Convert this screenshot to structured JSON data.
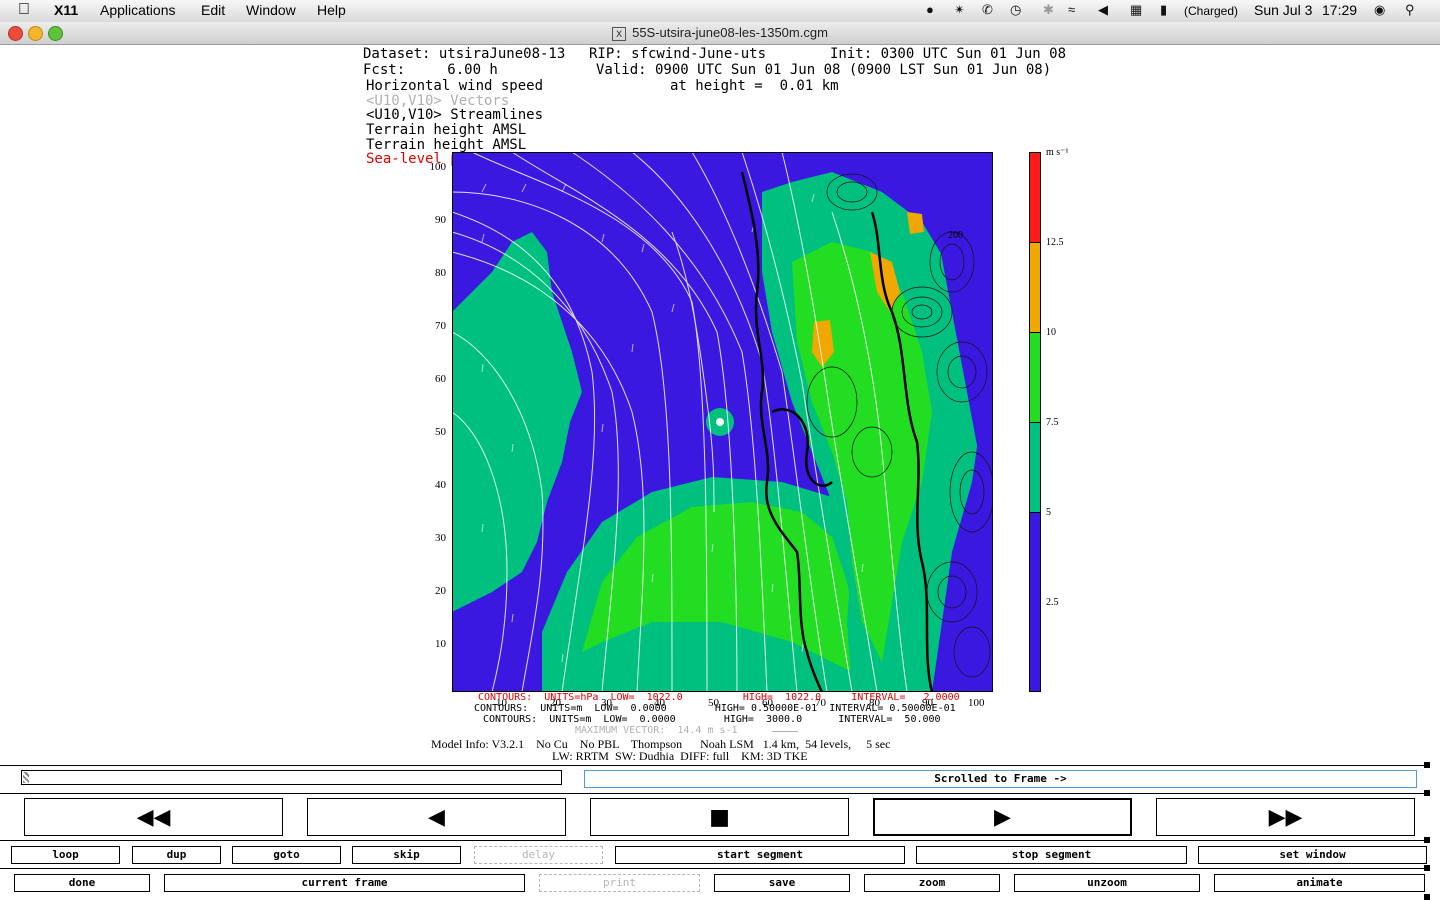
{
  "menubar": {
    "app": "X11",
    "items": [
      "Applications",
      "Edit",
      "Window",
      "Help"
    ],
    "battery_status": "(Charged)",
    "date": "Sun Jul 3",
    "time": "17:29"
  },
  "window": {
    "title": "55S-utsira-june08-les-1350m.cgm"
  },
  "plot": {
    "header": {
      "dataset": "Dataset: utsiraJune08-13",
      "rip": "RIP: sfcwind-June-uts",
      "init": "Init: 0300 UTC Sun 01 Jun 08",
      "fcst": "Fcst:     6.00 h",
      "valid": "Valid: 0900 UTC Sun 01 Jun 08 (0900 LST Sun 01 Jun 08)",
      "field1": "Horizontal wind speed",
      "height": "at height =  0.01 km",
      "field2": "<U10,V10> Vectors",
      "field3": "<U10,V10> Streamlines",
      "field4": "Terrain height AMSL",
      "field5": "Terrain height AMSL",
      "field6": "Sea-level pressure"
    },
    "y_ticks": [
      "100",
      "90",
      "80",
      "70",
      "60",
      "50",
      "40",
      "30",
      "20",
      "10"
    ],
    "x_ticks": [
      "10",
      "20",
      "30",
      "40",
      "50",
      "60",
      "70",
      "80",
      "90",
      "100"
    ],
    "colorbar": {
      "unit": "m s⁻¹",
      "labels": [
        "12.5",
        "10",
        "7.5",
        "5",
        "2.5"
      ],
      "colors": [
        "#ff1a1a",
        "#f0a800",
        "#22dd22",
        "#00c080",
        "#3a18e0"
      ]
    },
    "contours": {
      "line1": "CONTOURS:  UNITS=hPa  LOW=  1022.0          HIGH=  1022.0     INTERVAL=   2.0000",
      "line2": "CONTOURS:  UNITS=m  LOW=  0.0000        HIGH= 0.50000E-01  INTERVAL= 0.50000E-01",
      "line3": "CONTOURS:  UNITS=m  LOW=  0.0000        HIGH=  3000.0      INTERVAL=  50.000",
      "max_vector": "MAXIMUM VECTOR:  14.4 m s-1"
    },
    "model_info": {
      "line1": "Model Info: V3.2.1    No Cu    No PBL    Thompson      Noah LSM   1.4 km,  54 levels,     5 sec",
      "line2": "LW: RRTM  SW: Dudhia  DIFF: full    KM: 3D TKE"
    },
    "station_label": "200"
  },
  "controls": {
    "frame_status": "Scrolled to Frame ->",
    "big_buttons": {
      "rewind": "◀◀",
      "back": "◀",
      "stop": "■",
      "play": "▶",
      "fast_forward": "▶▶"
    },
    "row1": [
      "loop",
      "dup",
      "goto",
      "skip",
      "delay",
      "start segment",
      "stop segment",
      "set window"
    ],
    "row2": [
      "done",
      "current frame",
      "print",
      "save",
      "zoom",
      "unzoom",
      "animate"
    ]
  },
  "colors": {
    "accent_red": "#e00000",
    "field_gray": "#b0b0b0"
  }
}
